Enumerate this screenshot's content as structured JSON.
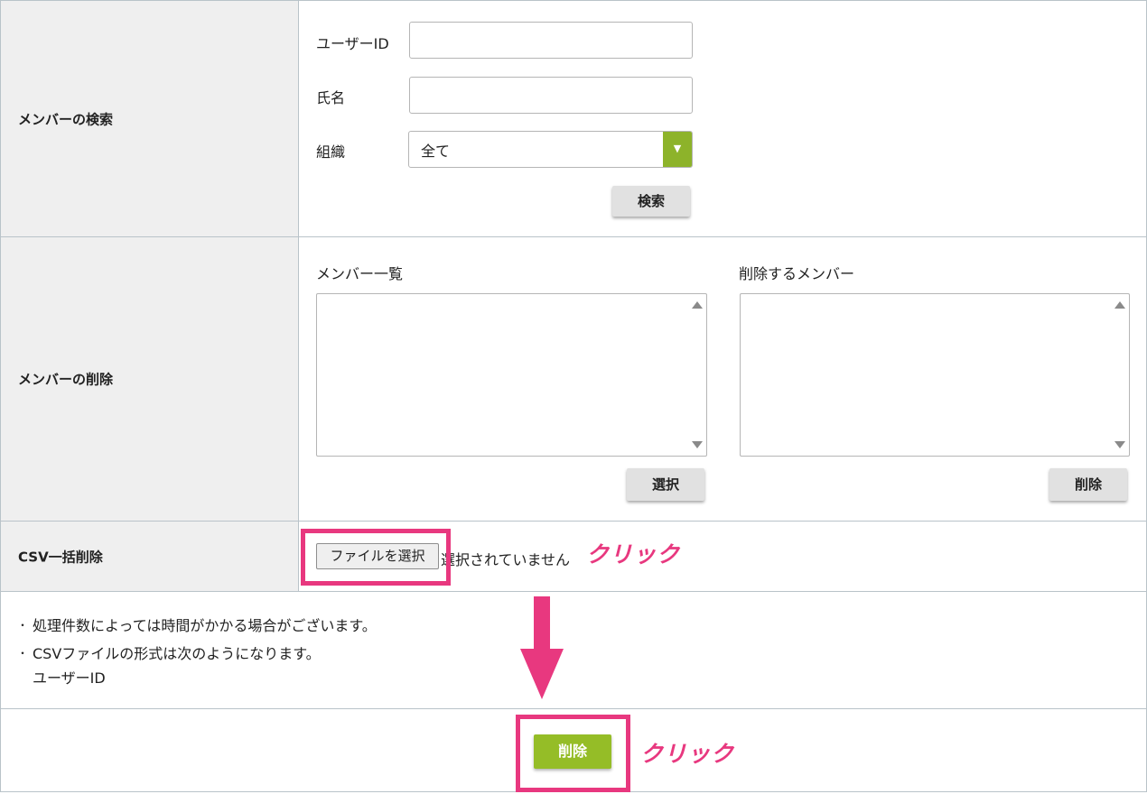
{
  "search_section": {
    "heading": "メンバーの検索",
    "user_id_label": "ユーザーID",
    "user_id_value": "",
    "name_label": "氏名",
    "name_value": "",
    "org_label": "組織",
    "org_value": "全て",
    "search_button": "検索"
  },
  "delete_section": {
    "heading": "メンバーの削除",
    "member_list_label": "メンバー一覧",
    "delete_list_label": "削除するメンバー",
    "select_button": "選択",
    "remove_button": "削除"
  },
  "csv_section": {
    "heading": "CSV一括削除",
    "file_button": "ファイルを選択",
    "file_status": "選択されていません"
  },
  "notes": [
    "処理件数によっては時間がかかる場合がございます。",
    "CSVファイルの形式は次のようになります。",
    "ユーザーID"
  ],
  "bullet_glyph": "・",
  "submit_button": "削除",
  "annotations": {
    "click_label": "クリック",
    "highlight_color": "#e8387f"
  },
  "colors": {
    "accent_green": "#95bd27",
    "header_bg": "#efefef"
  }
}
